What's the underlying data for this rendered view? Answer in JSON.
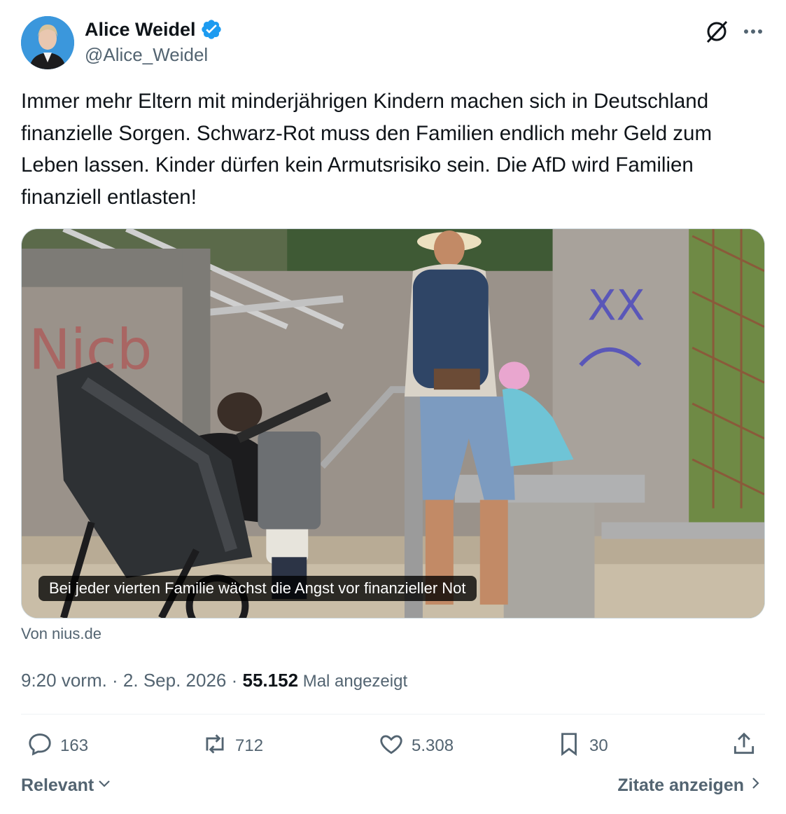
{
  "author": {
    "name": "Alice Weidel",
    "handle": "@Alice_Weidel",
    "verified_color": "#1d9bf0"
  },
  "tweet": {
    "text": "Immer mehr Eltern mit minderjährigen Kindern machen sich in Deutschland finanzielle Sorgen. Schwarz-Rot muss den Familien endlich mehr Geld zum Leben lassen. Kinder dürfen kein Armutsrisiko sein. Die AfD wird Familien finanziell entlasten!"
  },
  "media": {
    "caption": "Bei jeder vierten Familie wächst die Angst vor finanzieller Not",
    "source": "Von nius.de"
  },
  "meta": {
    "time_date": "9:20 vorm. · 2. Sep. 2026 · ",
    "views": "55.152",
    "views_label": " Mal angezeigt"
  },
  "actions": {
    "replies": "163",
    "reposts": "712",
    "likes": "5.308",
    "bookmarks": "30"
  },
  "footer": {
    "sort_label": "Relevant",
    "quotes_label": "Zitate anzeigen"
  },
  "icons": {
    "verified": "verified-badge-icon",
    "grok": "grok-icon",
    "more": "more-icon",
    "reply": "reply-icon",
    "repost": "repost-icon",
    "like": "like-icon",
    "bookmark": "bookmark-icon",
    "share": "share-icon"
  }
}
